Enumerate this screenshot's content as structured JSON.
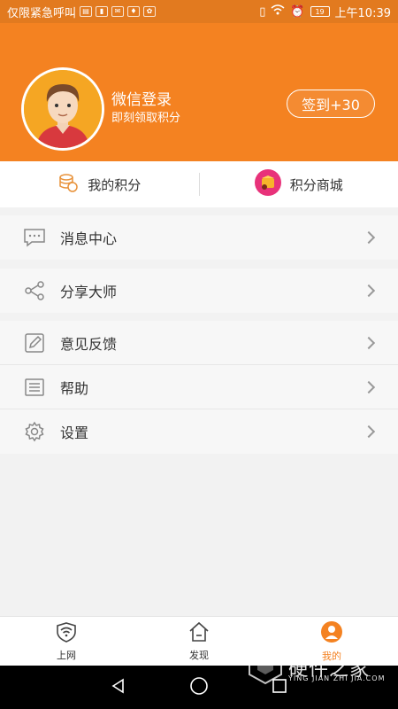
{
  "status_bar": {
    "left_text": "仅限紧急呼叫",
    "battery": "19",
    "time": "上午10:39"
  },
  "profile": {
    "login_title": "微信登录",
    "login_subtitle": "即刻领取积分",
    "checkin_label": "签到+30"
  },
  "points_bar": {
    "my_points": "我的积分",
    "points_mall": "积分商城"
  },
  "menu": {
    "group1": [
      {
        "label": "消息中心",
        "icon": "message-icon"
      }
    ],
    "group2": [
      {
        "label": "分享大师",
        "icon": "share-icon"
      }
    ],
    "group3": [
      {
        "label": "意见反馈",
        "icon": "feedback-icon"
      },
      {
        "label": "帮助",
        "icon": "help-icon"
      },
      {
        "label": "设置",
        "icon": "settings-icon"
      }
    ]
  },
  "bottom_nav": [
    {
      "label": "上网",
      "icon": "wifi-shield-icon"
    },
    {
      "label": "发现",
      "icon": "home-icon"
    },
    {
      "label": "我的",
      "icon": "user-icon",
      "active": true
    }
  ],
  "watermark": {
    "title": "硬件之家",
    "subtitle": "YING JIAN ZHI JIA.COM"
  },
  "colors": {
    "accent": "#f48221",
    "status_bar": "#e27a1f"
  }
}
